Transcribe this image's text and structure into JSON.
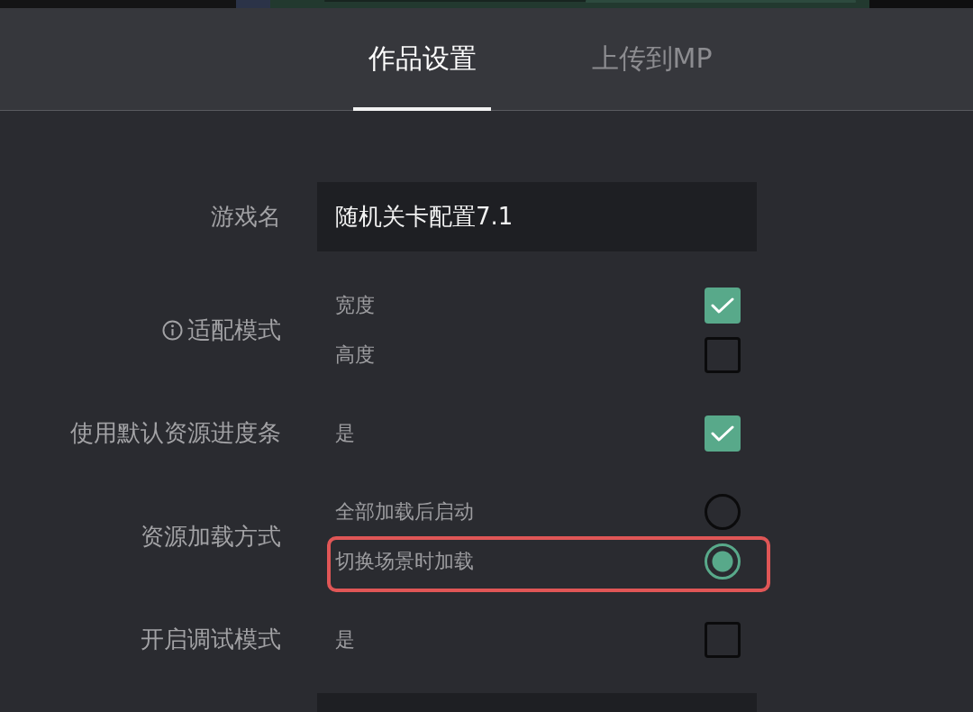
{
  "tabs": [
    {
      "label": "作品设置",
      "selected": true
    },
    {
      "label": "上传到MP",
      "selected": false
    }
  ],
  "settings": [
    {
      "kind": "text",
      "label": "游戏名",
      "value": "随机关卡配置7.1"
    },
    {
      "kind": "checkboxes",
      "label": "适配模式",
      "info": true,
      "options": [
        {
          "label": "宽度",
          "checked": true
        },
        {
          "label": "高度",
          "checked": false
        }
      ]
    },
    {
      "kind": "checkboxes",
      "label": "使用默认资源进度条",
      "options": [
        {
          "label": "是",
          "checked": true
        }
      ]
    },
    {
      "kind": "radios",
      "label": "资源加载方式",
      "options": [
        {
          "label": "全部加载后启动",
          "selected": false
        },
        {
          "label": "切换场景时加载",
          "selected": true,
          "highlighted": true
        }
      ]
    },
    {
      "kind": "checkboxes",
      "label": "开启调试模式",
      "options": [
        {
          "label": "是",
          "checked": false
        }
      ]
    },
    {
      "kind": "text"
    }
  ]
}
